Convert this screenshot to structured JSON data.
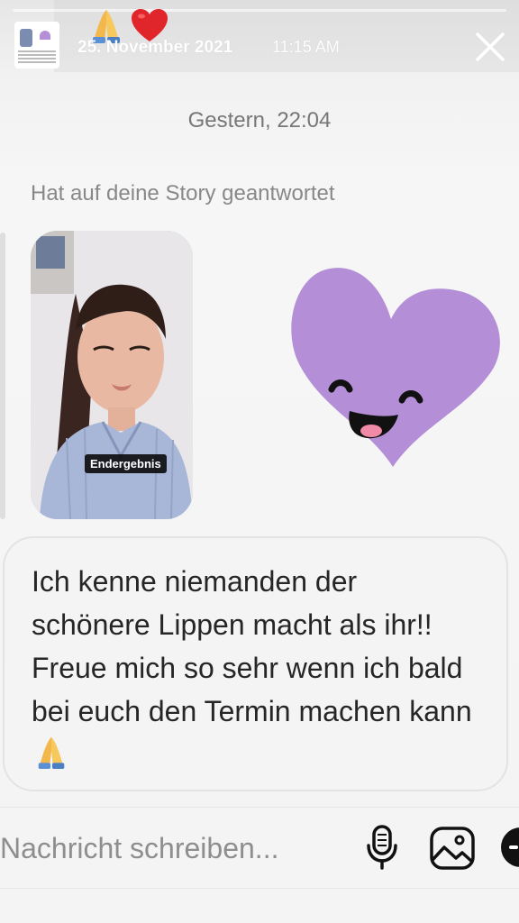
{
  "story_header": {
    "date": "25. November 2021",
    "time": "11:15 AM",
    "emojis": [
      "folded-hands-emoji",
      "red-heart-emoji"
    ]
  },
  "thread": {
    "timestamp": "Gestern, 22:04",
    "reply_note": "Hat auf deine Story geantwortet",
    "story_label": "Endergebnis",
    "sticker": "smiling-purple-heart-sticker",
    "message": "Ich kenne niemanden der schönere Lippen macht als ihr!! Freue mich so sehr wenn ich bald bei euch den Termin machen kann",
    "message_emoji": "folded-hands-emoji"
  },
  "composer": {
    "placeholder": "Nachricht schreiben..."
  },
  "colors": {
    "background": "#f4f4f4",
    "sticker_purple": "#b48fd8",
    "bubble_border": "#e3e3e3"
  }
}
